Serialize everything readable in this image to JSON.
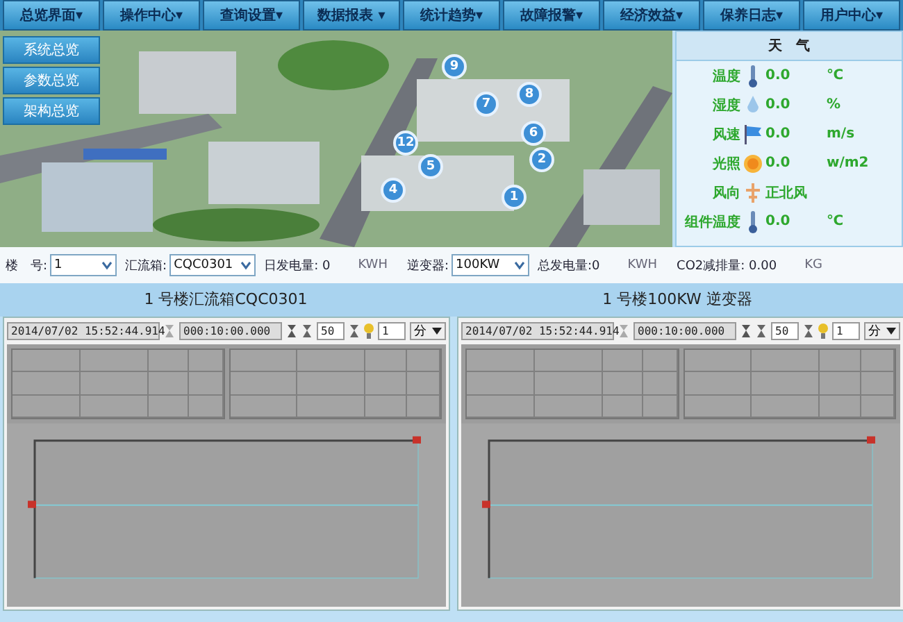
{
  "menu": [
    "总览界面▾",
    "操作中心▾",
    "查询设置▾",
    "数据报表 ▾",
    "统计趋势▾",
    "故障报警▾",
    "经济效益▾",
    "保养日志▾",
    "用户中心▾"
  ],
  "side_buttons": [
    "系统总览",
    "参数总览",
    "架构总览"
  ],
  "map": {
    "kind": "picture",
    "pins": [
      "9",
      "8",
      "7",
      "6",
      "12",
      "5",
      "2",
      "4",
      "1"
    ]
  },
  "weather": {
    "title": "天　气",
    "rows": [
      {
        "kind": "thermometer",
        "label": "温度",
        "value": "0.0",
        "unit": "℃"
      },
      {
        "kind": "drop",
        "label": "湿度",
        "value": "0.0",
        "unit": "%"
      },
      {
        "kind": "flag",
        "label": "风速",
        "value": "0.0",
        "unit": "m/s"
      },
      {
        "kind": "sun",
        "label": "光照",
        "value": "0.0",
        "unit": "w/m2"
      },
      {
        "kind": "vane",
        "label": "风向",
        "value": "正北风"
      },
      {
        "kind": "thermometer",
        "label": "组件温度",
        "value": "0.0",
        "unit": "℃"
      }
    ]
  },
  "controls": [
    {
      "kind": "select",
      "label": "楼　号:",
      "value": "1"
    },
    {
      "kind": "select",
      "label": "汇流箱:",
      "value": "CQC0301"
    },
    {
      "kind": "reading",
      "label": "日发电量: 0",
      "unit": "KWH"
    },
    {
      "kind": "select",
      "label": "逆变器:",
      "value": "100KW"
    },
    {
      "kind": "reading",
      "label": "总发电量:0",
      "unit": "KWH"
    },
    {
      "kind": "reading",
      "label": "CO2减排量: 0.00",
      "unit": "KG"
    }
  ],
  "panels": [
    {
      "title": "1 号楼汇流箱CQC0301",
      "toolbar": {
        "time": "2014/07/02 15:52:44.914",
        "span": "000:10:00.000",
        "count": "50",
        "step": "1",
        "unit": "分"
      }
    },
    {
      "title": "1 号楼100KW 逆变器",
      "toolbar": {
        "time": "2014/07/02 15:52:44.914",
        "span": "000:10:00.000",
        "count": "50",
        "step": "1",
        "unit": "分"
      }
    }
  ]
}
